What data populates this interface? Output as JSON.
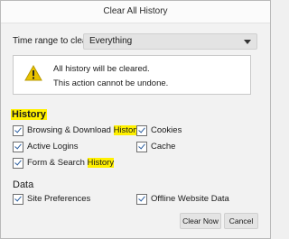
{
  "dialog": {
    "title": "Clear All History"
  },
  "range": {
    "label": "Time range to clear:",
    "value": "Everything"
  },
  "warning": {
    "line1": "All history will be cleared.",
    "line2": "This action cannot be undone."
  },
  "history": {
    "title": "History",
    "browsing_prefix": "Browsing & Download ",
    "browsing_hl": "History",
    "active_logins": "Active Logins",
    "form_prefix": "Form & Search ",
    "form_hl": "History",
    "cookies": "Cookies",
    "cache": "Cache"
  },
  "data": {
    "title": "Data",
    "site_prefs": "Site Preferences",
    "offline": "Offline Website Data"
  },
  "buttons": {
    "clear_now": "Clear Now",
    "cancel": "Cancel"
  },
  "colors": {
    "highlight": "#fff000",
    "warning_icon": "#e8c200"
  },
  "icons": {
    "warning": "warning-triangle-icon",
    "dropdown": "chevron-down-icon"
  }
}
